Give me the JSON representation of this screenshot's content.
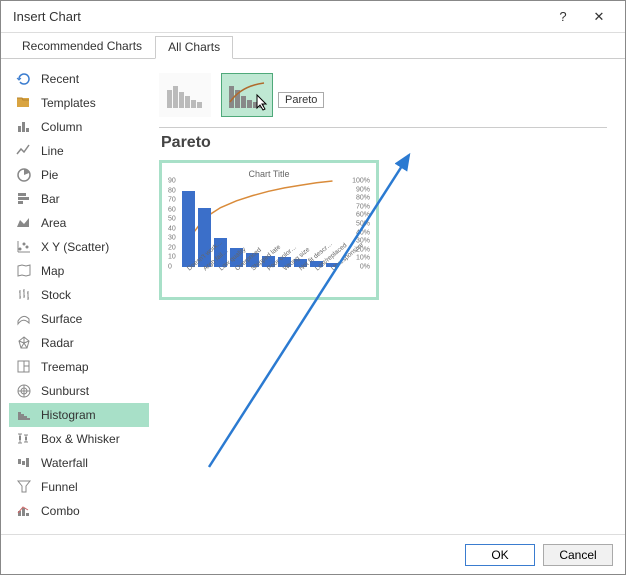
{
  "title": "Insert Chart",
  "help_label": "?",
  "close_label": "✕",
  "tabs": {
    "recommended": "Recommended Charts",
    "all": "All Charts",
    "active": "all"
  },
  "sidebar": [
    {
      "id": "recent",
      "label": "Recent"
    },
    {
      "id": "templates",
      "label": "Templates"
    },
    {
      "id": "column",
      "label": "Column"
    },
    {
      "id": "line",
      "label": "Line"
    },
    {
      "id": "pie",
      "label": "Pie"
    },
    {
      "id": "bar",
      "label": "Bar"
    },
    {
      "id": "area",
      "label": "Area"
    },
    {
      "id": "xy",
      "label": "X Y (Scatter)"
    },
    {
      "id": "map",
      "label": "Map"
    },
    {
      "id": "stock",
      "label": "Stock"
    },
    {
      "id": "surface",
      "label": "Surface"
    },
    {
      "id": "radar",
      "label": "Radar"
    },
    {
      "id": "treemap",
      "label": "Treemap"
    },
    {
      "id": "sunburst",
      "label": "Sunburst"
    },
    {
      "id": "histogram",
      "label": "Histogram",
      "selected": true
    },
    {
      "id": "boxwhisker",
      "label": "Box & Whisker"
    },
    {
      "id": "waterfall",
      "label": "Waterfall"
    },
    {
      "id": "funnel",
      "label": "Funnel"
    },
    {
      "id": "combo",
      "label": "Combo"
    }
  ],
  "subtype": {
    "tooltip": "Pareto",
    "title": "Pareto"
  },
  "preview": {
    "chart_title": "Chart Title"
  },
  "chart_data": {
    "type": "bar",
    "title": "Chart Title",
    "categories": [
      "Doesn't work…",
      "Argh fail…",
      "Low quality",
      "Overpriced",
      "Shipped late",
      "Poor color…",
      "Wrong size",
      "Not fit descr…",
      "Lost/replaced",
      "Unresponsive"
    ],
    "values": [
      80,
      62,
      30,
      20,
      15,
      12,
      10,
      8,
      6,
      4
    ],
    "cumulative_pct": [
      32,
      57,
      69,
      77,
      83,
      88,
      92,
      95,
      98,
      100
    ],
    "ylabel": "",
    "ylim": [
      0,
      90
    ],
    "y_ticks": [
      0,
      10,
      20,
      30,
      40,
      50,
      60,
      70,
      80,
      90
    ],
    "right_ticks_pct": [
      0,
      10,
      20,
      30,
      40,
      50,
      60,
      70,
      80,
      90,
      100
    ]
  },
  "buttons": {
    "ok": "OK",
    "cancel": "Cancel"
  },
  "colors": {
    "accent": "#3b6fc9",
    "pareto_line": "#d98b3a",
    "highlight": "#a8e0c8",
    "arrow": "#2b7ad1"
  }
}
